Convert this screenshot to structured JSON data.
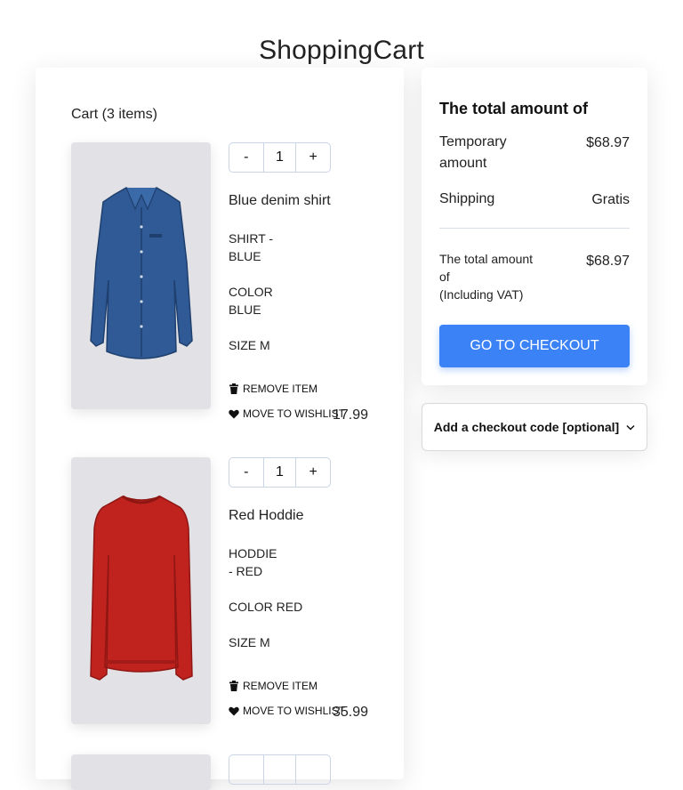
{
  "page": {
    "title": "ShoppingCart"
  },
  "cart": {
    "heading": "Cart (3 items)",
    "remove_label": "REMOVE ITEM",
    "wishlist_label": "MOVE TO WISHLIST",
    "items": [
      {
        "name": "Blue denim shirt",
        "quantity": "1",
        "type": "SHIRT - BLUE",
        "color": "COLOR BLUE",
        "size": "SIZE M",
        "price": "17.99",
        "image": "blue-denim-shirt",
        "image_color": "#2f5a96"
      },
      {
        "name": "Red Hoddie",
        "quantity": "1",
        "type": "HODDIE - RED",
        "color": "COLOR RED",
        "size": "SIZE M",
        "price": "35.99",
        "image": "red-hoodie",
        "image_color": "#c0221e"
      }
    ],
    "minus_label": "-",
    "plus_label": "+"
  },
  "summary": {
    "title": "The total amount of",
    "temporary_label": "Temporary amount",
    "temporary_value": "$68.97",
    "shipping_label": "Shipping",
    "shipping_value": "Gratis",
    "total_label_line1": "The total amount of",
    "total_label_line2": "(Including VAT)",
    "total_value": "$68.97",
    "checkout_label": "GO TO CHECKOUT"
  },
  "checkout_code": {
    "label": "Add a checkout code [optional]"
  },
  "colors": {
    "accent": "#3b82f6",
    "image_bg": "#e2e2e6"
  }
}
